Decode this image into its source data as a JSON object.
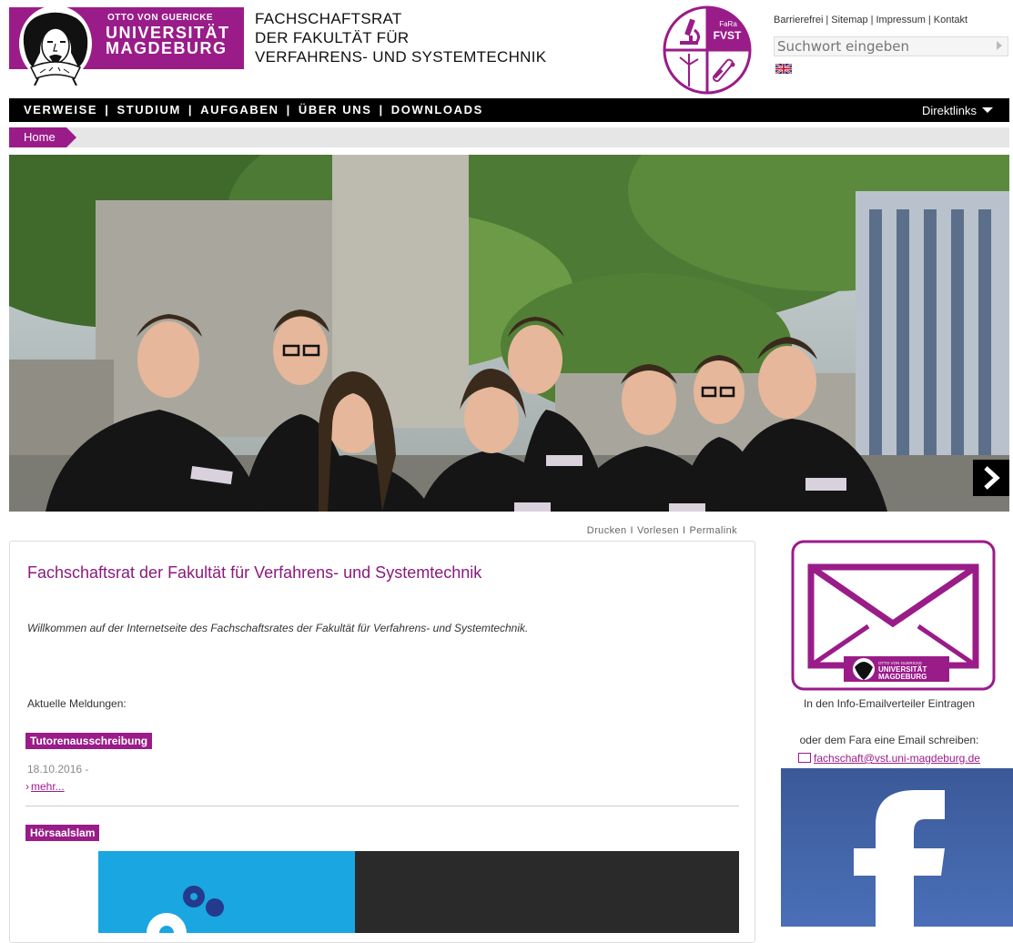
{
  "header": {
    "logo": {
      "line1": "OTTO VON GUERICKE",
      "line2": "UNIVERSITÄT",
      "line3": "MAGDEBURG"
    },
    "site_title": {
      "line1": "FACHSCHAFTSRAT",
      "line2": "DER FAKULTÄT FÜR",
      "line3": "VERFAHRENS- UND SYSTEMTECHNIK"
    },
    "fara_logo": {
      "small": "FaRa",
      "big": "FVST"
    },
    "toplinks": [
      "Barrierefrei",
      "Sitemap",
      "Impressum",
      "Kontakt"
    ],
    "search": {
      "placeholder": "Suchwort eingeben"
    },
    "flag_icon": "uk-flag-icon"
  },
  "nav": {
    "items": [
      "VERWEISE",
      "STUDIUM",
      "AUFGABEN",
      "ÜBER UNS",
      "DOWNLOADS"
    ],
    "separator": "|",
    "direktlinks": "Direktlinks"
  },
  "breadcrumb": {
    "home": "Home"
  },
  "tools": {
    "print": "Drucken",
    "read": "Vorlesen",
    "permalink": "Permalink",
    "separator": "I"
  },
  "main": {
    "title": "Fachschaftsrat der Fakultät für Verfahrens- und Systemtechnik",
    "intro": "Willkommen auf der Internetseite des Fachschaftsrates der Fakultät für Verfahrens- und Systemtechnik.",
    "news_label": "Aktuelle Meldungen:",
    "news": [
      {
        "title": "Tutorenausschreibung",
        "date": "18.10.2016 -",
        "more": "mehr..."
      },
      {
        "title": "Hörsaalslam"
      }
    ]
  },
  "sidebar": {
    "mailing_caption": "In den Info-Emailverteiler Eintragen",
    "mail_caption": "oder dem Fara eine Email schreiben:",
    "mail_address": "fachschaft@vst.uni-magdeburg.de",
    "envelope_logo": {
      "line1": "OTTO VON GUERICKE",
      "line2": "UNIVERSITÄT",
      "line3": "MAGDEBURG"
    }
  },
  "colors": {
    "brand_purple": "#9a1c89",
    "title_purple": "#8b1a7d",
    "nav_black": "#000000",
    "facebook_blue": "#3b5998"
  }
}
